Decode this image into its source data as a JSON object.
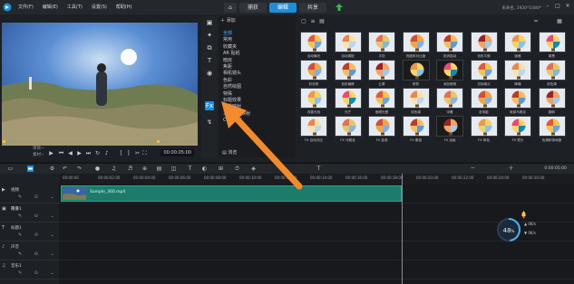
{
  "app": {
    "menu": [
      "文件(F)",
      "编辑(E)",
      "工具(T)",
      "设置(S)",
      "帮助(H)"
    ],
    "tabs": [
      {
        "label": "捕获",
        "active": false
      },
      {
        "label": "编辑",
        "active": true
      },
      {
        "label": "共享",
        "active": false
      }
    ],
    "resolution_info": "未命名, 1920*1080*",
    "accent": "#1e8fd6"
  },
  "player": {
    "project_label": "项目~",
    "clip_label": "素材~",
    "timecode": "00:00:05:00"
  },
  "library": {
    "add_label": "添加",
    "categories": [
      {
        "label": "全部",
        "active": true
      },
      {
        "label": "常用",
        "active": false
      },
      {
        "label": "收藏夹",
        "active": false
      },
      {
        "label": "AR 贴纸",
        "active": false
      },
      {
        "label": "暗房",
        "active": false
      },
      {
        "label": "焦距",
        "active": false
      },
      {
        "label": "相机镜头",
        "active": false
      },
      {
        "label": "色彩",
        "active": false
      },
      {
        "label": "自然绘图",
        "active": false
      },
      {
        "label": "特殊",
        "active": false
      },
      {
        "label": "标题效果",
        "active": false
      },
      {
        "label": "二维映射",
        "active": false
      },
      {
        "label": "三维纹理映射",
        "active": false
      },
      {
        "label": "Corel FX",
        "active": false
      }
    ],
    "footer_label": "浏览",
    "thumbnails": [
      "自动曝光",
      "自动调配",
      "平坦",
      "亮度和对比度",
      "抵消摇动",
      "色彩平衡",
      "幽雅",
      "雾黑",
      "彩色笔",
      "色彩偏移",
      "云雾",
      "修剪",
      "添加暗角",
      "去除噪点",
      "降噪",
      "双色调",
      "改善光线",
      "光芒",
      "鱼眼光晕",
      "双色调",
      "浮雕",
      "老电影",
      "局部马赛克",
      "翻转",
      "FX 自动对比",
      "FX 马赛克",
      "FX 漩涡",
      "FX 素描",
      "FX 油画",
      "FX 单色",
      "FX 镜头",
      "色调和饱和度"
    ]
  },
  "timeline": {
    "timecode": "0:00:05:00",
    "ruler": [
      "00:00:00",
      "00:00:02:00",
      "00:00:04:00",
      "00:00:06:00",
      "00:00:08:00",
      "00:00:10:00",
      "00:00:12:00",
      "00:00:14:00",
      "00:00:16:00",
      "00:00:18:00",
      "00:00:20:00",
      "00:00:22:00",
      "00:00:24:00",
      "00:00:26:00"
    ],
    "tracks": [
      "视频",
      "覆叠1",
      "标题1",
      "声音",
      "音乐1"
    ],
    "clip_name": "Sample_360.mp4",
    "gauge_value": "48",
    "gauge_unit": "%",
    "gauge_percent": 48,
    "speed_up": "0K/s",
    "speed_down": "0K/s"
  }
}
